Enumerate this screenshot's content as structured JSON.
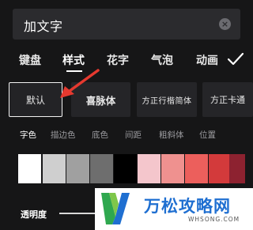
{
  "input": {
    "value": "加文字"
  },
  "tabs": [
    {
      "label": "键盘"
    },
    {
      "label": "样式"
    },
    {
      "label": "花字"
    },
    {
      "label": "气泡"
    },
    {
      "label": "动画"
    }
  ],
  "active_tab": "样式",
  "fonts": [
    {
      "label": "默认"
    },
    {
      "label": "喜脉体"
    },
    {
      "label": "方正行楷简体"
    },
    {
      "label": "方正卡通"
    }
  ],
  "selected_font": "默认",
  "style_subtabs": [
    {
      "label": "字色"
    },
    {
      "label": "描边色"
    },
    {
      "label": "底色"
    },
    {
      "label": "间距"
    },
    {
      "label": "粗斜体"
    },
    {
      "label": "位置"
    }
  ],
  "active_subtab": "字色",
  "swatches": [
    {
      "color": "#ffffff"
    },
    {
      "color": "#cfcfcf"
    },
    {
      "color": "#a0a0a0"
    },
    {
      "color": "#6e6e6e"
    },
    {
      "color": "#000000"
    },
    {
      "color": "#f4c6cc"
    },
    {
      "color": "#ef918f"
    },
    {
      "color": "#ec5f5c"
    },
    {
      "color": "#d33a3b"
    },
    {
      "color": "#8d2230"
    }
  ],
  "opacity": {
    "label": "透明度"
  },
  "watermark": {
    "title": "万松攻略网",
    "subtitle": "WHSONG.COM"
  },
  "colors": {
    "accent_arrow": "#e5392f",
    "watermark_blue": "#1f6fd1",
    "watermark_green": "#2fa84f"
  }
}
